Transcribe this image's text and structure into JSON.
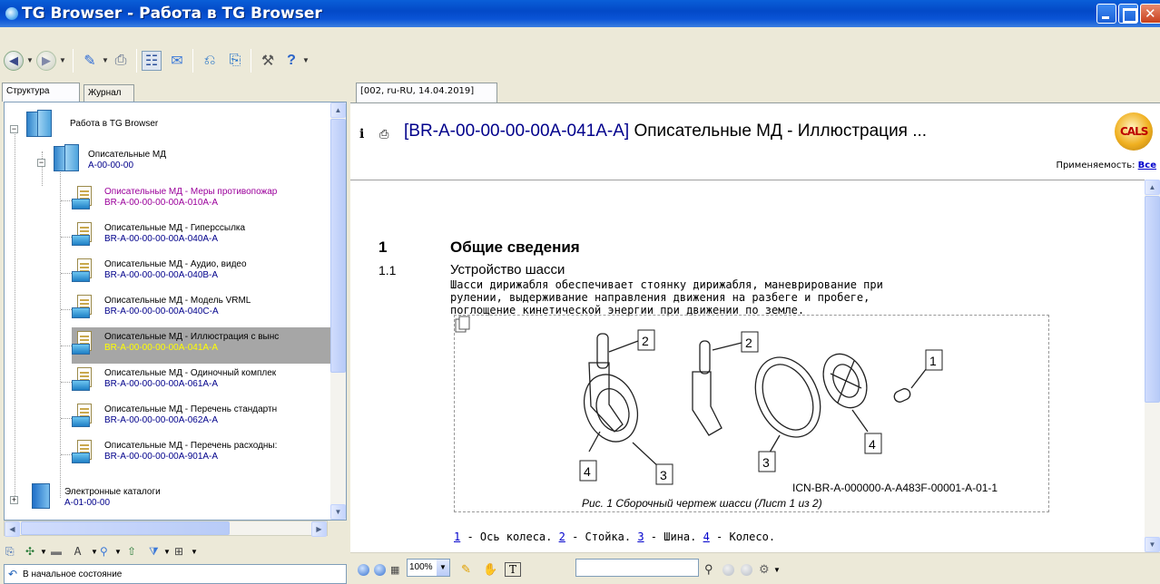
{
  "window": {
    "title": "TG Browser - Работа в TG Browser"
  },
  "toolbar": {
    "icons": [
      "back-icon",
      "forward-icon",
      "open-icon",
      "print-icon",
      "tree-view-icon",
      "comment-icon",
      "previous-icon",
      "next-icon",
      "tools-icon",
      "help-icon"
    ]
  },
  "left_tabs": [
    {
      "label": "Структура",
      "active": true
    },
    {
      "label": "Журнал",
      "active": false
    }
  ],
  "tree": {
    "root": {
      "title": "Работа в TG Browser"
    },
    "group": {
      "title": "Описательные МД",
      "code": "A-00-00-00"
    },
    "items": [
      {
        "title": "Описательные МД - Меры противопожар",
        "code": "BR-A-00-00-00-00A-010A-A",
        "visited": true
      },
      {
        "title": "Описательные МД - Гиперссылка",
        "code": "BR-A-00-00-00-00A-040A-A"
      },
      {
        "title": "Описательные МД - Аудио, видео",
        "code": "BR-A-00-00-00-00A-040B-A"
      },
      {
        "title": "Описательные МД - Модель VRML",
        "code": "BR-A-00-00-00-00A-040C-A"
      },
      {
        "title": "Описательные МД - Иллюстрация с вынс",
        "code": "BR-A-00-00-00-00A-041A-A",
        "selected": true
      },
      {
        "title": "Описательные МД - Одиночный комплек",
        "code": "BR-A-00-00-00-00A-061A-A"
      },
      {
        "title": "Описательные МД - Перечень стандартн",
        "code": "BR-A-00-00-00-00A-062A-A"
      },
      {
        "title": "Описательные МД - Перечень расходны:",
        "code": "BR-A-00-00-00-00A-901A-A"
      }
    ],
    "catalog": {
      "title": "Электронные каталоги",
      "code": "A-01-00-00"
    }
  },
  "status_left": {
    "text": "В начальное состояние"
  },
  "doc_tab": {
    "label": "[002, ru-RU, 14.04.2019]"
  },
  "doc_header": {
    "code": "[BR-A-00-00-00-00A-041A-A]",
    "title": " Описательные МД - Иллюстрация ...",
    "logo_text": "CALS",
    "applicability_label": "Применяемость:",
    "applicability_value": "Все"
  },
  "doc": {
    "section_number": "1",
    "section_title": "Общие сведения",
    "subsection_number": "1.1",
    "subsection_title": "Устройство шасси",
    "paragraph_lines": [
      "Шасси дирижабля обеспечивает стоянку дирижабля, маневрирование при",
      "рулении, выдерживание направления движения на разбеге и пробеге,",
      "поглощение кинетической энергии при движении по земле."
    ],
    "figure": {
      "icn": "ICN-BR-A-000000-A-A483F-00001-A-01-1",
      "caption": "Рис. 1  Сборочный чертеж шасси (Лист 1 из 2)",
      "callouts": [
        "2",
        "2",
        "1",
        "4",
        "3",
        "3",
        "4"
      ]
    },
    "legend": [
      {
        "num": "1",
        "text": " - Ось колеса. "
      },
      {
        "num": "2",
        "text": " - Стойка. "
      },
      {
        "num": "3",
        "text": " - Шина. "
      },
      {
        "num": "4",
        "text": " - Колесо."
      }
    ]
  },
  "doc_toolbar": {
    "zoom": "100%",
    "search_value": ""
  }
}
